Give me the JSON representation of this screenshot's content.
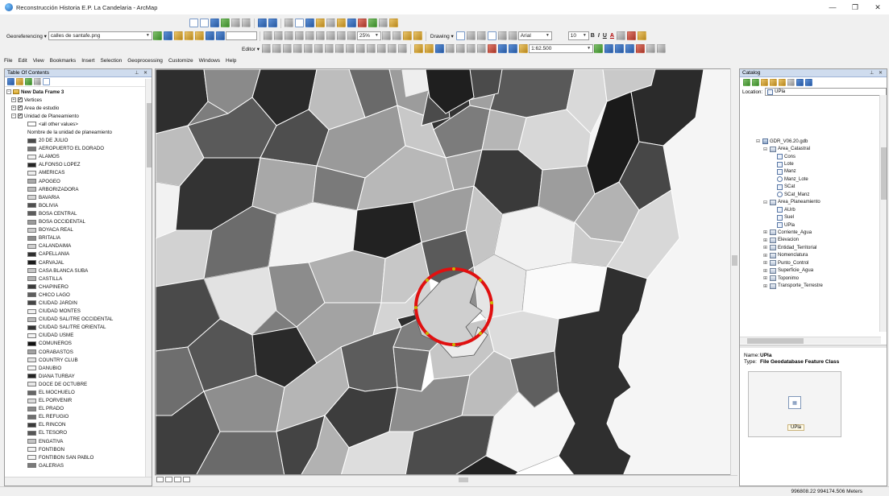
{
  "window": {
    "title": "Reconstrucción Historia E.P. La Candelaria - ArcMap"
  },
  "georef": {
    "label": "Georeferencing ▾",
    "layer": "calles de santafe.png"
  },
  "drawing": {
    "label": "Drawing ▾",
    "font": "Arial",
    "size": "10",
    "bold": "B",
    "italic": "I",
    "underline": "U",
    "color_a": "A"
  },
  "editor": {
    "label": "Editor ▾",
    "scale": "1:62.500",
    "scale_small": "25%"
  },
  "menu": [
    "File",
    "Edit",
    "View",
    "Bookmarks",
    "Insert",
    "Selection",
    "Geoprocessing",
    "Customize",
    "Windows",
    "Help"
  ],
  "toc": {
    "title": "Table Of Contents",
    "frame": "New Data Frame 3",
    "layers": [
      "Vertices",
      "Area de estudio",
      "Unidad de Planeamiento"
    ],
    "other_values": "<all other values>",
    "field_name": "Nombre de la unidad de planeamiento",
    "classes": [
      {
        "label": "20 DE JULIO",
        "color": "#4a4a4a"
      },
      {
        "label": "AEROPUERTO EL DORADO",
        "color": "#777777"
      },
      {
        "label": "ALAMOS",
        "color": "#f2f2f2"
      },
      {
        "label": "ALFONSO LOPEZ",
        "color": "#262626"
      },
      {
        "label": "AMERICAS",
        "color": "#eeeeee"
      },
      {
        "label": "APOGEO",
        "color": "#aaaaaa"
      },
      {
        "label": "ARBORIZADORA",
        "color": "#bdbdbd"
      },
      {
        "label": "BAVARIA",
        "color": "#d6d6d6"
      },
      {
        "label": "BOLIVIA",
        "color": "#4f4f4f"
      },
      {
        "label": "BOSA CENTRAL",
        "color": "#5c5c5c"
      },
      {
        "label": "BOSA OCCIDENTAL",
        "color": "#9a9a9a"
      },
      {
        "label": "BOYACA REAL",
        "color": "#cccccc"
      },
      {
        "label": "BRITALIA",
        "color": "#8c8c8c"
      },
      {
        "label": "CALANDAIMA",
        "color": "#d0d0d0"
      },
      {
        "label": "CAPELLANIA",
        "color": "#2e2e2e"
      },
      {
        "label": "CARVAJAL",
        "color": "#1c1c1c"
      },
      {
        "label": "CASA BLANCA SUBA",
        "color": "#c6c6c6"
      },
      {
        "label": "CASTILLA",
        "color": "#b3b3b3"
      },
      {
        "label": "CHAPINERO",
        "color": "#3b3b3b"
      },
      {
        "label": "CHICO LAGO",
        "color": "#5e5e5e"
      },
      {
        "label": "CIUDAD JARDIN",
        "color": "#444444"
      },
      {
        "label": "CIUDAD MONTES",
        "color": "#f0f0f0"
      },
      {
        "label": "CIUDAD SALITRE OCCIDENTAL",
        "color": "#bcbcbc"
      },
      {
        "label": "CIUDAD SALITRE ORIENTAL",
        "color": "#333333"
      },
      {
        "label": "CIUDAD USME",
        "color": "#f4f4f4"
      },
      {
        "label": "COMUNEROS",
        "color": "#111111"
      },
      {
        "label": "CORABASTOS",
        "color": "#a2a2a2"
      },
      {
        "label": "COUNTRY CLUB",
        "color": "#e4e4e4"
      },
      {
        "label": "DANUBIO",
        "color": "#f5f5f5"
      },
      {
        "label": "DIANA TURBAY",
        "color": "#242424"
      },
      {
        "label": "DOCE DE OCTUBRE",
        "color": "#e8e8e8"
      },
      {
        "label": "EL MOCHUELO",
        "color": "#666666"
      },
      {
        "label": "EL PORVENIR",
        "color": "#dcdcdc"
      },
      {
        "label": "EL PRADO",
        "color": "#8a8a8a"
      },
      {
        "label": "EL REFUGIO",
        "color": "#6e6e6e"
      },
      {
        "label": "EL RINCON",
        "color": "#3a3a3a"
      },
      {
        "label": "EL TESORO",
        "color": "#555555"
      },
      {
        "label": "ENGATIVA",
        "color": "#c4c4c4"
      },
      {
        "label": "FONTIBON",
        "color": "#f3f3f3"
      },
      {
        "label": "FONTIBON SAN PABLO",
        "color": "#f6f6f6"
      },
      {
        "label": "GALERIAS",
        "color": "#7a7a7a"
      }
    ]
  },
  "catalog": {
    "title": "Catalog",
    "location_label": "Location:",
    "location_value": "UPla",
    "tree": [
      {
        "label": "GDR_V06.20.gdb",
        "type": "gdb",
        "indent": 0,
        "exp": "⊟"
      },
      {
        "label": "Area_Catastral",
        "type": "fds",
        "indent": 1,
        "exp": "⊟"
      },
      {
        "label": "Cons",
        "type": "fc",
        "indent": 2,
        "exp": ""
      },
      {
        "label": "Lote",
        "type": "fc",
        "indent": 2,
        "exp": ""
      },
      {
        "label": "Manz",
        "type": "fc",
        "indent": 2,
        "exp": ""
      },
      {
        "label": "Manz_Lote",
        "type": "rel",
        "indent": 2,
        "exp": ""
      },
      {
        "label": "SCat",
        "type": "fc",
        "indent": 2,
        "exp": ""
      },
      {
        "label": "SCat_Manz",
        "type": "rel",
        "indent": 2,
        "exp": ""
      },
      {
        "label": "Area_Planeamiento",
        "type": "fds",
        "indent": 1,
        "exp": "⊟"
      },
      {
        "label": "AUrb",
        "type": "fc",
        "indent": 2,
        "exp": ""
      },
      {
        "label": "Suel",
        "type": "fc",
        "indent": 2,
        "exp": ""
      },
      {
        "label": "UPla",
        "type": "fc",
        "indent": 2,
        "exp": ""
      },
      {
        "label": "Corriente_Agua",
        "type": "fds",
        "indent": 1,
        "exp": "⊞"
      },
      {
        "label": "Elevacion",
        "type": "fds",
        "indent": 1,
        "exp": "⊞"
      },
      {
        "label": "Entidad_Territorial",
        "type": "fds",
        "indent": 1,
        "exp": "⊞"
      },
      {
        "label": "Nomenclatura",
        "type": "fds",
        "indent": 1,
        "exp": "⊞"
      },
      {
        "label": "Punto_Control",
        "type": "fds",
        "indent": 1,
        "exp": "⊞"
      },
      {
        "label": "Superficie_Agua",
        "type": "fds",
        "indent": 1,
        "exp": "⊞"
      },
      {
        "label": "Toponimo",
        "type": "fds",
        "indent": 1,
        "exp": "⊞"
      },
      {
        "label": "Transporte_Terrestre",
        "type": "fds",
        "indent": 1,
        "exp": "⊞"
      }
    ],
    "name_label": "Name:",
    "name_value": "UPla",
    "type_label": "Type:",
    "type_value": "File Geodatabase Feature Class",
    "preview_label": "UPla"
  },
  "status": {
    "coords": "996808.22  994174.506 Meters"
  },
  "colors": {
    "panel_header": "#cfdcee",
    "highlight_circle": "#e01010"
  }
}
